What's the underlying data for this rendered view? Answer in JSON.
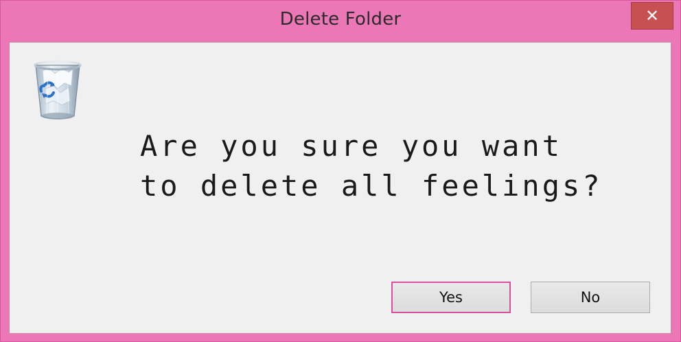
{
  "window": {
    "title": "Delete Folder",
    "close_glyph": "✕"
  },
  "dialog": {
    "icon": "recycle-bin-icon",
    "message_line1": "Are you sure you want",
    "message_line2": "to delete all feelings?"
  },
  "buttons": {
    "yes_label": "Yes",
    "no_label": "No"
  },
  "colors": {
    "frame": "#ec77b6",
    "close_button": "#c75050",
    "content_bg": "#f0f0f0",
    "focus_border": "#d94fa0"
  }
}
